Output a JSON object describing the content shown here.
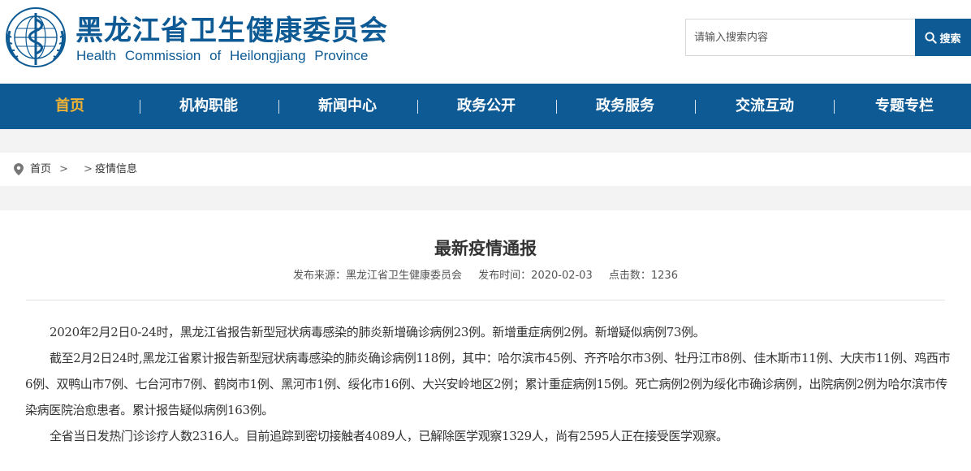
{
  "header": {
    "title_cn": "黑龙江省卫生健康委员会",
    "title_en": "Health Commission of Heilongjiang Province",
    "logo_icon": "who-emblem-icon",
    "brand_color": "#0d5a94"
  },
  "search": {
    "placeholder": "请输入搜索内容",
    "button_label": "搜索",
    "button_icon": "search-icon"
  },
  "nav": {
    "items": [
      {
        "label": "首页",
        "active": true
      },
      {
        "label": "机构职能"
      },
      {
        "label": "新闻中心"
      },
      {
        "label": "政务公开"
      },
      {
        "label": "政务服务"
      },
      {
        "label": "交流互动"
      },
      {
        "label": "专题专栏"
      }
    ],
    "active_color": "#f3b333"
  },
  "breadcrumb": {
    "icon": "location-pin-icon",
    "home": "首页",
    "sep1": ">",
    "sep2": ">",
    "current": "疫情信息"
  },
  "article": {
    "title": "最新疫情通报",
    "meta": {
      "source": "发布来源：黑龙江省卫生健康委员会",
      "time": "发布时间：2020-02-03",
      "views": "点击数：1236"
    },
    "paragraphs": [
      "2020年2月2日0-24时，黑龙江省报告新型冠状病毒感染的肺炎新增确诊病例23例。新增重症病例2例。新增疑似病例73例。",
      "截至2月2日24时,黑龙江省累计报告新型冠状病毒感染的肺炎确诊病例118例，其中：哈尔滨市45例、齐齐哈尔市3例、牡丹江市8例、佳木斯市11例、大庆市11例、鸡西市6例、双鸭山市7例、七台河市7例、鹤岗市1例、黑河市1例、绥化市16例、大兴安岭地区2例；累计重症病例15例。死亡病例2例为绥化市确诊病例，出院病例2例为哈尔滨市传染病医院治愈患者。累计报告疑似病例163例。",
      "全省当日发热门诊诊疗人数2316人。目前追踪到密切接触者4089人，已解除医学观察1329人，尚有2595人正在接受医学观察。"
    ]
  }
}
